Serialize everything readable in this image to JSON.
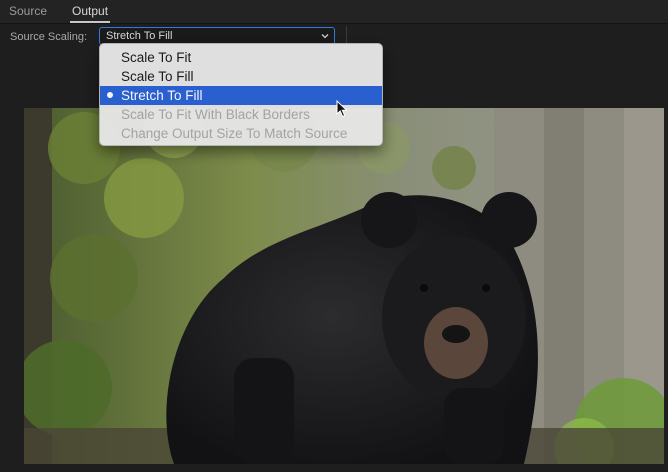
{
  "tabs": [
    {
      "label": "Source"
    },
    {
      "label": "Output"
    }
  ],
  "scaling": {
    "label": "Source Scaling:",
    "value": "Stretch To Fill"
  },
  "menu": {
    "items": [
      {
        "label": "Scale To Fit",
        "state": "normal"
      },
      {
        "label": "Scale To Fill",
        "state": "normal"
      },
      {
        "label": "Stretch To Fill",
        "state": "selected"
      },
      {
        "label": "Scale To Fit With Black Borders",
        "state": "disabled"
      },
      {
        "label": "Change Output Size To Match Source",
        "state": "disabled"
      }
    ]
  },
  "icons": {
    "dropdown": "chevron-down-icon",
    "selection": "radio-dot-icon",
    "pointer": "arrow-cursor-icon"
  },
  "colors": {
    "accent": "#2a62d6",
    "focus_border": "#2e7cd6",
    "panel_bg": "#1e1e1e",
    "menu_bg": "#e7e7e7"
  }
}
